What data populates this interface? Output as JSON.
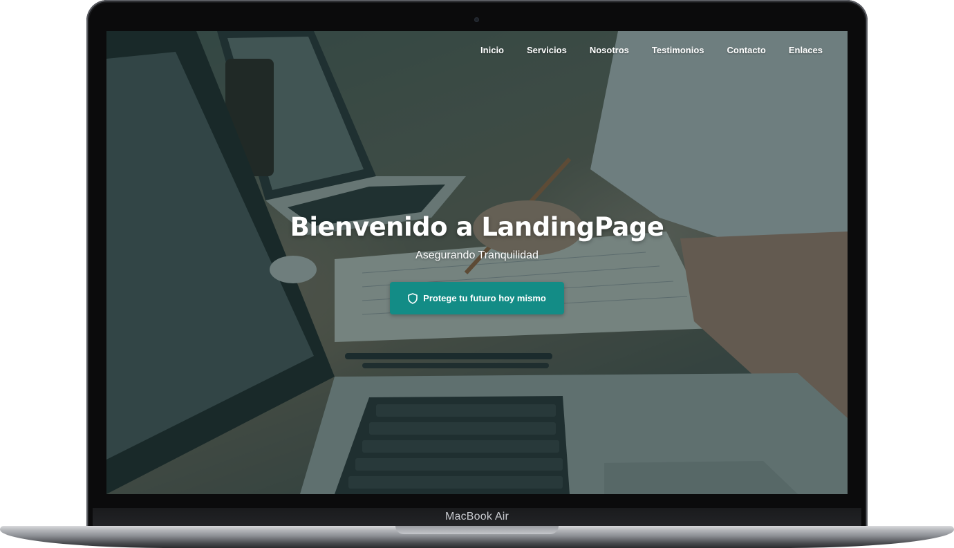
{
  "device": {
    "label": "MacBook Air"
  },
  "nav": {
    "items": [
      {
        "label": "Inicio"
      },
      {
        "label": "Servicios"
      },
      {
        "label": "Nosotros"
      },
      {
        "label": "Testimonios"
      },
      {
        "label": "Contacto"
      },
      {
        "label": "Enlaces"
      }
    ]
  },
  "hero": {
    "title": "Bienvenido a LandingPage",
    "subtitle": "Asegurando Tranquilidad",
    "cta": {
      "label": "Protege tu futuro hoy mismo",
      "icon": "shield-icon"
    }
  },
  "colors": {
    "accent": "#138c86",
    "overlay": "#163230",
    "text": "#ffffff"
  }
}
